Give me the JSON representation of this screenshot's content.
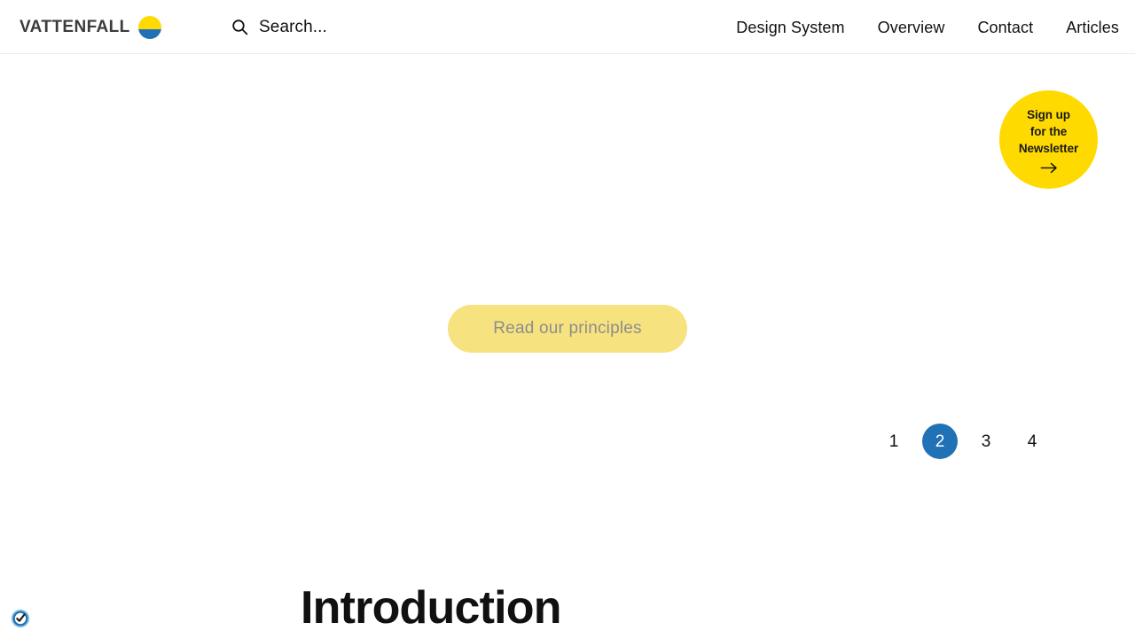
{
  "header": {
    "brand": {
      "wordmark": "VATTENFALL",
      "logo_icon": "vattenfall-circle-icon",
      "logo_colors": {
        "top": "#FFDA00",
        "bottom": "#2071B5"
      }
    },
    "search": {
      "icon": "search-icon",
      "placeholder": "Search...",
      "value": ""
    },
    "nav": [
      {
        "label": "Design System"
      },
      {
        "label": "Overview"
      },
      {
        "label": "Contact"
      },
      {
        "label": "Articles"
      }
    ]
  },
  "newsletter": {
    "line1": "Sign up",
    "line2": "for the",
    "line3": "Newsletter",
    "arrow_icon": "arrow-right-icon",
    "background": "#FFDA00",
    "text_color": "#1A1A1A"
  },
  "main": {
    "principles_button": {
      "label": "Read our principles",
      "background": "#F6E27F",
      "text_color": "#8D8D8D"
    },
    "pagination": {
      "items": [
        "1",
        "2",
        "3",
        "4"
      ],
      "active_index": 1,
      "active_background": "#2071B5",
      "active_text_color": "#FFFFFF"
    },
    "section_heading": "Introduction"
  },
  "footer": {
    "privacy_badge": {
      "icon": "check-badge-icon",
      "color": "#2071B5"
    }
  }
}
